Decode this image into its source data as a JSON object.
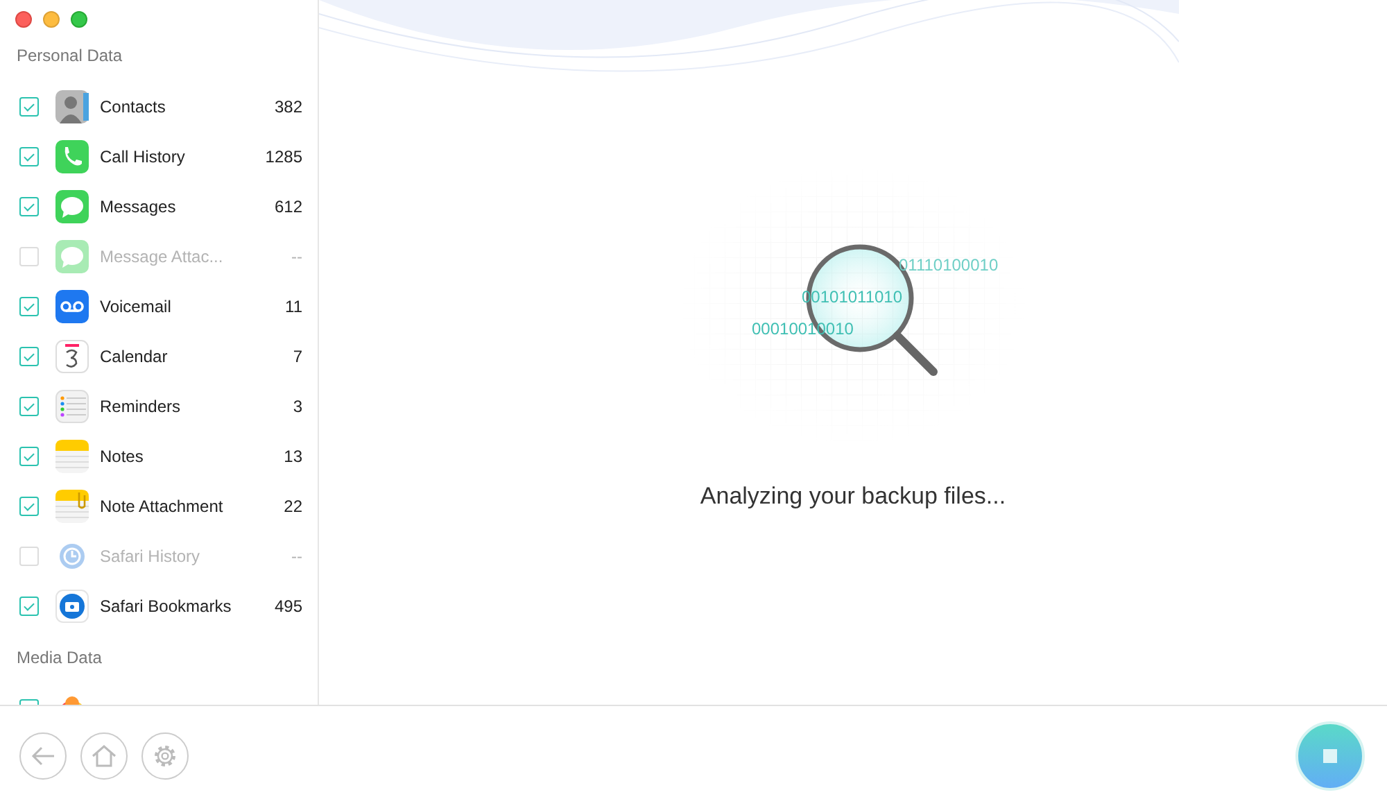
{
  "sidebar": {
    "sections": [
      {
        "title": "Personal Data",
        "items": [
          {
            "kind": "contacts",
            "label": "Contacts",
            "count": "382",
            "checked": true,
            "disabled": false
          },
          {
            "kind": "phone",
            "label": "Call History",
            "count": "1285",
            "checked": true,
            "disabled": false
          },
          {
            "kind": "messages",
            "label": "Messages",
            "count": "612",
            "checked": true,
            "disabled": false
          },
          {
            "kind": "attach",
            "label": "Message Attac...",
            "count": "--",
            "checked": false,
            "disabled": true
          },
          {
            "kind": "voicemail",
            "label": "Voicemail",
            "count": "11",
            "checked": true,
            "disabled": false
          },
          {
            "kind": "calendar",
            "label": "Calendar",
            "count": "7",
            "checked": true,
            "disabled": false
          },
          {
            "kind": "reminders",
            "label": "Reminders",
            "count": "3",
            "checked": true,
            "disabled": false
          },
          {
            "kind": "notes",
            "label": "Notes",
            "count": "13",
            "checked": true,
            "disabled": false
          },
          {
            "kind": "noteattach",
            "label": "Note Attachment",
            "count": "22",
            "checked": true,
            "disabled": false
          },
          {
            "kind": "history",
            "label": "Safari History",
            "count": "--",
            "checked": false,
            "disabled": true
          },
          {
            "kind": "bookmarks",
            "label": "Safari Bookmarks",
            "count": "495",
            "checked": true,
            "disabled": false
          }
        ]
      },
      {
        "title": "Media Data",
        "items": [
          {
            "kind": "photos",
            "disabled": false
          }
        ]
      }
    ]
  },
  "main": {
    "binary": [
      "01110100010",
      "00101011010",
      "00010010010"
    ],
    "status": "Analyzing your backup files..."
  }
}
